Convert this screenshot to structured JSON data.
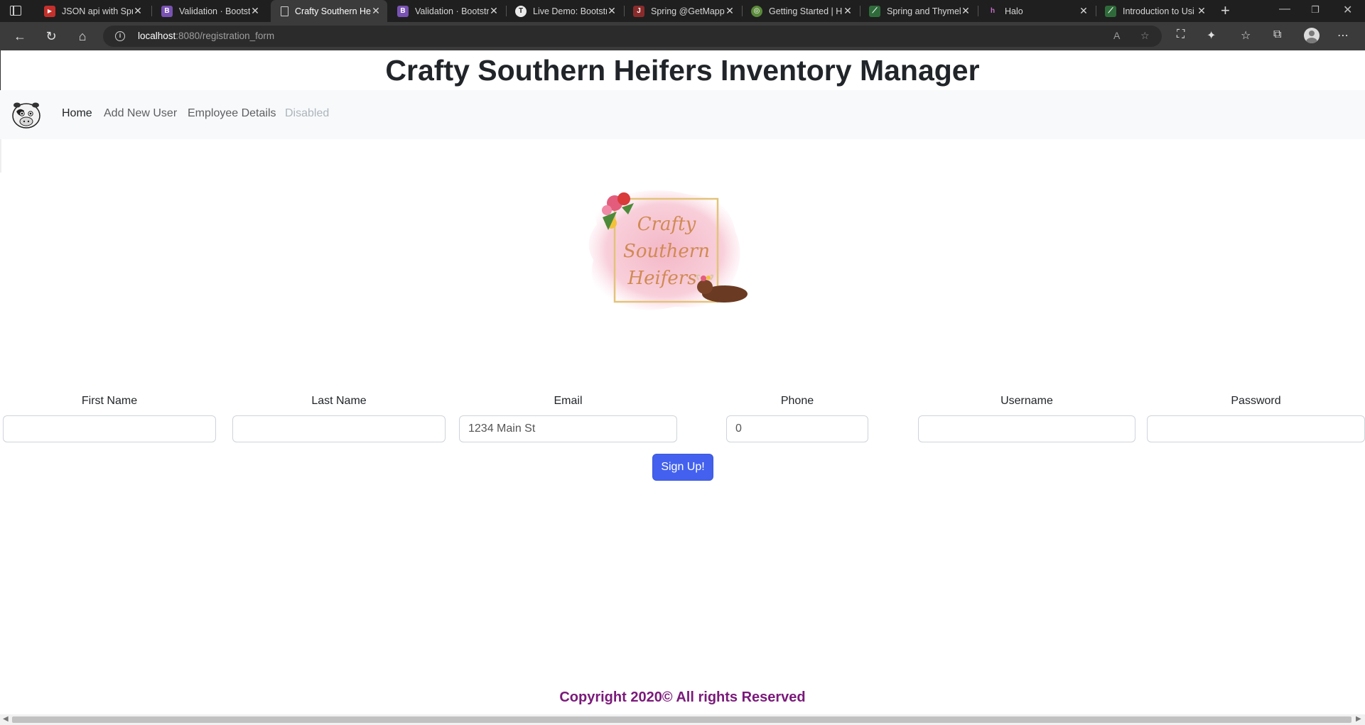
{
  "browser": {
    "tabs": [
      {
        "title": "JSON api with Spri",
        "favicon_color": "#c4302b",
        "favicon_glyph": "▶",
        "icon": "youtube-icon"
      },
      {
        "title": "Validation · Bootstr",
        "favicon_color": "#7952b3",
        "favicon_glyph": "B",
        "icon": "bootstrap-icon"
      },
      {
        "title": "Crafty Southern He",
        "favicon_color": "#3b3b3b",
        "favicon_glyph": "",
        "icon": "page-icon",
        "active": true
      },
      {
        "title": "Validation · Bootstr",
        "favicon_color": "#7952b3",
        "favicon_glyph": "B",
        "icon": "bootstrap-icon"
      },
      {
        "title": "Live Demo: Bootstr",
        "favicon_color": "#e8e8e8",
        "favicon_glyph": "T",
        "icon": "tutorial-icon"
      },
      {
        "title": "Spring @GetMappi",
        "favicon_color": "#8a2b2b",
        "favicon_glyph": "J",
        "icon": "java-icon"
      },
      {
        "title": "Getting Started | H",
        "favicon_color": "#5a8a3a",
        "favicon_glyph": "◎",
        "icon": "spring-icon"
      },
      {
        "title": "Spring and Thymel",
        "favicon_color": "#2f6b3a",
        "favicon_glyph": "⟋",
        "icon": "thymeleaf-icon"
      },
      {
        "title": "Halo",
        "favicon_color": "#1f1f1f",
        "favicon_glyph": "h",
        "icon": "halo-icon"
      },
      {
        "title": "Introduction to Usi",
        "favicon_color": "#2f6b3a",
        "favicon_glyph": "⟋",
        "icon": "thymeleaf-icon"
      }
    ],
    "url_host": "localhost",
    "url_rest": ":8080/registration_form"
  },
  "site": {
    "title": "Crafty Southern Heifers Inventory Manager",
    "nav": {
      "home": "Home",
      "add_user": "Add New User",
      "employee_details": "Employee Details",
      "disabled": "Disabled"
    },
    "logo_text": [
      "Crafty",
      "Southern",
      "Heifers"
    ]
  },
  "form": {
    "fields": [
      {
        "label": "First Name",
        "value": ""
      },
      {
        "label": "Last Name",
        "value": ""
      },
      {
        "label": "Email",
        "value": "1234 Main St"
      },
      {
        "label": "Phone",
        "value": "0"
      },
      {
        "label": "Username",
        "value": ""
      },
      {
        "label": "Password",
        "value": ""
      }
    ],
    "submit_label": "Sign Up!"
  },
  "footer": {
    "copyright": "Copyright 2020© All rights Reserved"
  },
  "colors": {
    "accent": "#4361ee",
    "footer_text": "#7a1a7a",
    "navbar_bg": "#f8f9fa"
  }
}
